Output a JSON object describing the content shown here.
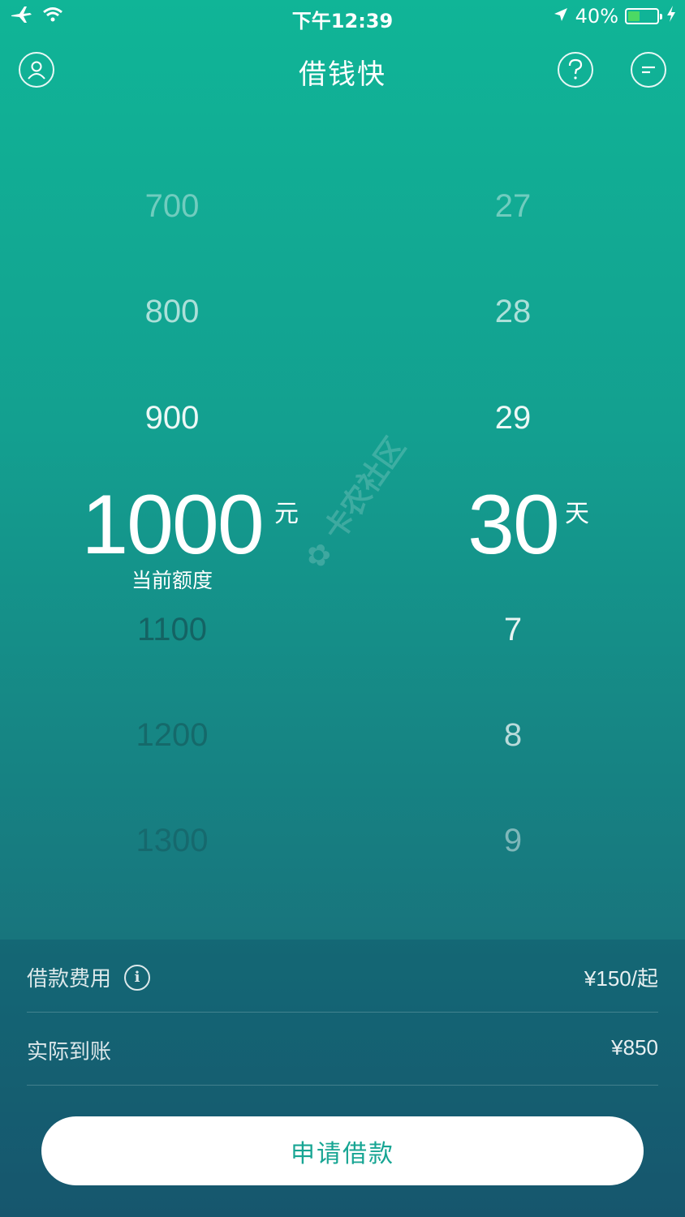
{
  "status_bar": {
    "time": "下午12:39",
    "battery_text": "40%",
    "battery_level": 0.4
  },
  "nav": {
    "title": "借钱快"
  },
  "amount_picker": {
    "above": [
      "700",
      "800",
      "900"
    ],
    "selected": "1000",
    "unit": "元",
    "sub_label": "当前额度",
    "below": [
      "1100",
      "1200",
      "1300"
    ]
  },
  "days_picker": {
    "above": [
      "27",
      "28",
      "29"
    ],
    "selected": "30",
    "unit": "天",
    "below": [
      "7",
      "8",
      "9"
    ]
  },
  "watermark": {
    "text": "卡农社区"
  },
  "summary": {
    "fee_label": "借款费用",
    "fee_value": "¥150/起",
    "received_label": "实际到账",
    "received_value": "¥850"
  },
  "apply_button": {
    "label": "申请借款"
  },
  "colors": {
    "accent": "#17a593",
    "battery_fill": "#4cd964"
  }
}
